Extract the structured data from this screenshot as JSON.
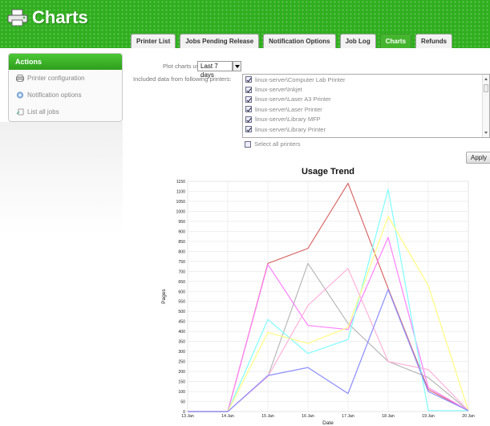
{
  "header": {
    "title": "Charts",
    "icon": "printer-icon"
  },
  "tabs": [
    {
      "label": "Printer List",
      "active": false
    },
    {
      "label": "Jobs Pending Release",
      "active": false
    },
    {
      "label": "Notification Options",
      "active": false
    },
    {
      "label": "Job Log",
      "active": false
    },
    {
      "label": "Charts",
      "active": true
    },
    {
      "label": "Refunds",
      "active": false
    }
  ],
  "sidebar": {
    "title": "Actions",
    "items": [
      {
        "label": "Printer configuration",
        "icon": "printer-icon"
      },
      {
        "label": "Notification options",
        "icon": "notification-icon"
      },
      {
        "label": "List all jobs",
        "icon": "list-icon"
      }
    ]
  },
  "form": {
    "period_label": "Plot charts using data over:",
    "period_value": "Last 7 days",
    "printers_label": "Included data from following printers:",
    "printers": [
      {
        "name": "linux-server\\Computer Lab Printer",
        "checked": true
      },
      {
        "name": "linux-server\\Inkjet",
        "checked": true
      },
      {
        "name": "linux-server\\Laser A3 Printer",
        "checked": true
      },
      {
        "name": "linux-server\\Laser Printer",
        "checked": true
      },
      {
        "name": "linux-server\\Library MFP",
        "checked": true
      },
      {
        "name": "linux-server\\Library Printer",
        "checked": true
      }
    ],
    "select_all_label": "Select all printers",
    "select_all_checked": false,
    "apply_label": "Apply"
  },
  "chart_data": {
    "type": "line",
    "title": "Usage Trend",
    "xlabel": "Date",
    "ylabel": "Pages",
    "categories": [
      "13 Jan",
      "14 Jan",
      "15 Jan",
      "16 Jan",
      "17 Jan",
      "18 Jan",
      "19 Jan",
      "20 Jan"
    ],
    "ylim": [
      0,
      1150
    ],
    "ytick_step": 50,
    "grid": true,
    "series": [
      {
        "color": "#d96b6b",
        "values": [
          0,
          0,
          740,
          815,
          1140,
          615,
          110,
          5
        ]
      },
      {
        "color": "#b8b8b8",
        "values": [
          0,
          0,
          175,
          740,
          440,
          250,
          170,
          5
        ]
      },
      {
        "color": "#ff80ff",
        "values": [
          0,
          0,
          735,
          430,
          410,
          870,
          120,
          5
        ]
      },
      {
        "color": "#80ffff",
        "values": [
          0,
          0,
          460,
          290,
          360,
          1110,
          5,
          5
        ]
      },
      {
        "color": "#ffff80",
        "values": [
          0,
          0,
          395,
          340,
          420,
          975,
          630,
          5
        ]
      },
      {
        "color": "#ffb3d9",
        "values": [
          0,
          0,
          175,
          530,
          715,
          250,
          210,
          5
        ]
      },
      {
        "color": "#8c8cff",
        "values": [
          0,
          0,
          180,
          220,
          90,
          610,
          100,
          5
        ]
      }
    ]
  }
}
